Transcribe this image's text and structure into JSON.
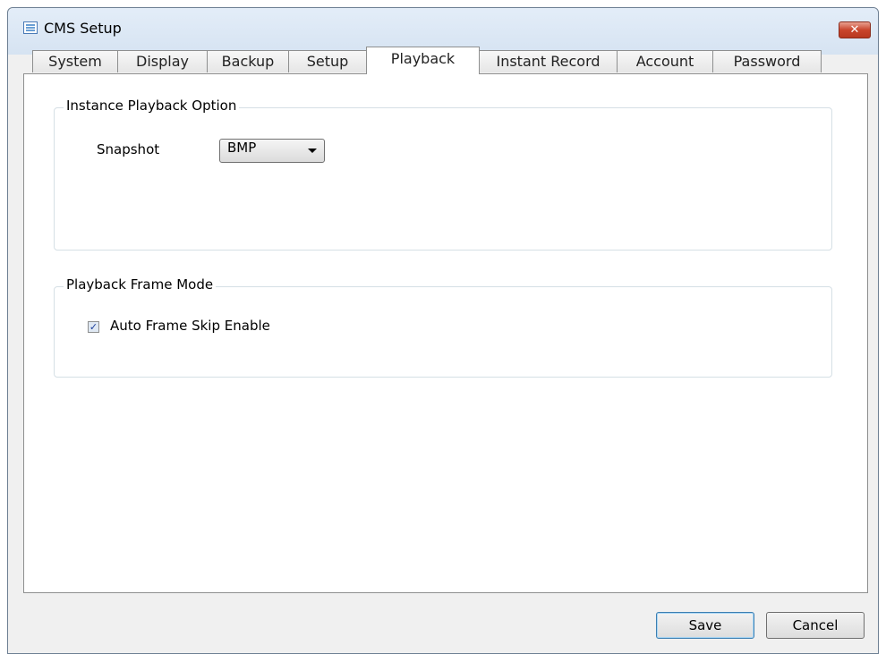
{
  "window": {
    "title": "CMS Setup",
    "close_label": "✕"
  },
  "tabs": [
    {
      "label": "System"
    },
    {
      "label": "Display"
    },
    {
      "label": "Backup"
    },
    {
      "label": "Setup"
    },
    {
      "label": "Playback",
      "active": true
    },
    {
      "label": "Instant Record"
    },
    {
      "label": "Account"
    },
    {
      "label": "Password"
    }
  ],
  "instance_playback": {
    "legend": "Instance Playback Option",
    "snapshot_label": "Snapshot",
    "snapshot_value": "BMP"
  },
  "frame_mode": {
    "legend": "Playback Frame Mode",
    "auto_skip_label": "Auto Frame Skip Enable",
    "auto_skip_checked": true,
    "check_glyph": "✓"
  },
  "buttons": {
    "save": "Save",
    "cancel": "Cancel"
  }
}
